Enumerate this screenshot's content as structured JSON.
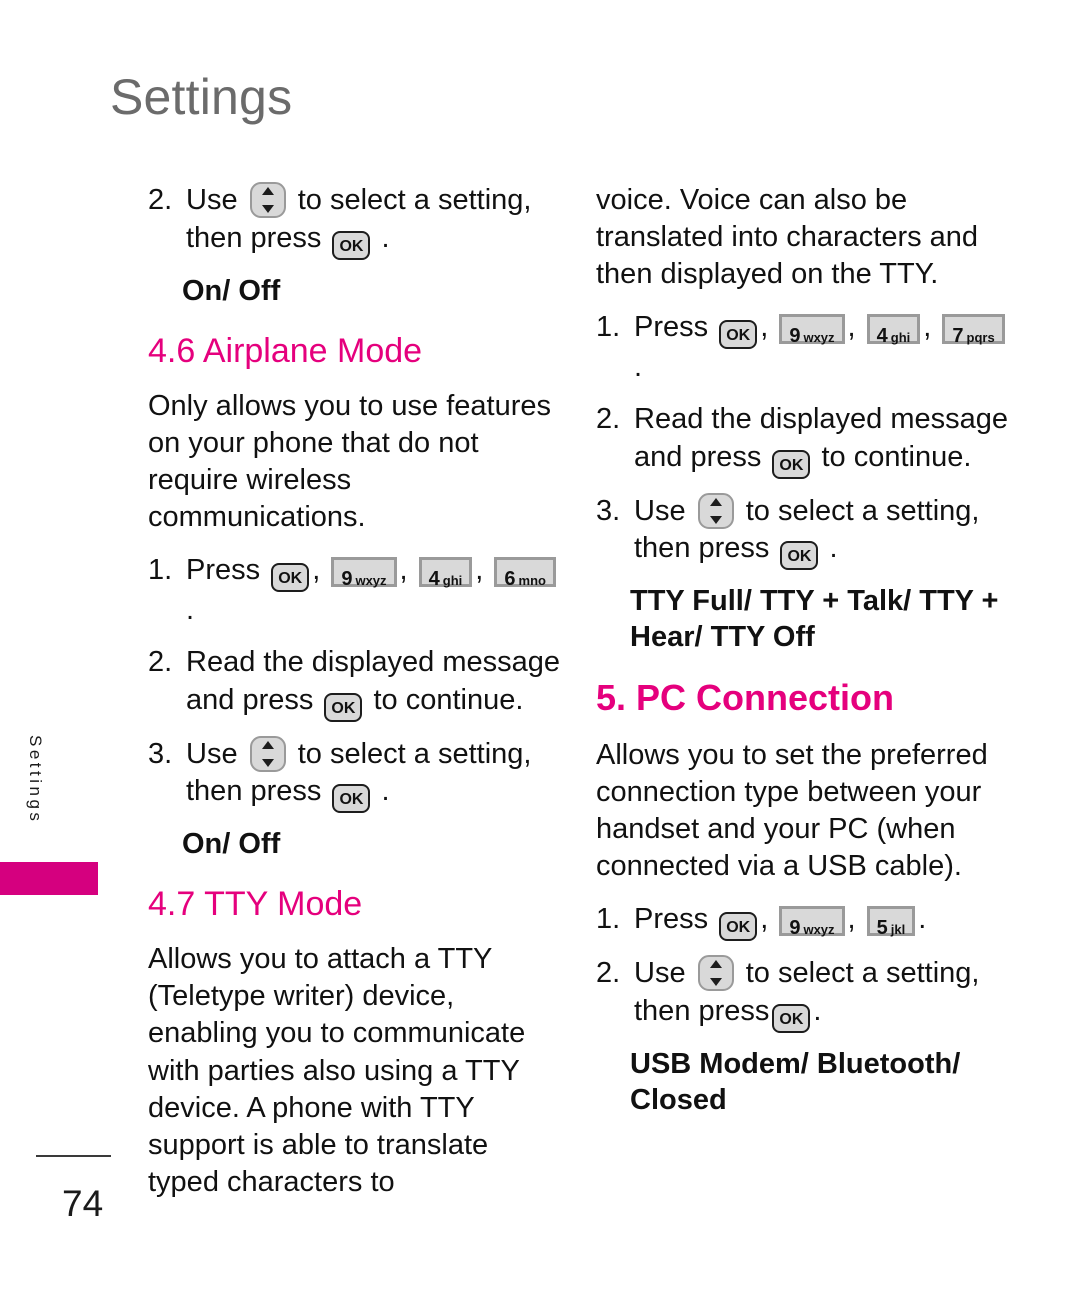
{
  "page": {
    "title": "Settings",
    "side_label": "Settings",
    "number": "74",
    "accent_color": "#e5007d",
    "tab_color": "#d5007f",
    "title_color": "#6b6b6b"
  },
  "keys": {
    "ok": "OK",
    "nav": "nav-up-down",
    "k9": {
      "digit": "9",
      "letters": "wxyz"
    },
    "k4": {
      "digit": "4",
      "letters": "ghi"
    },
    "k6": {
      "digit": "6",
      "letters": "mno"
    },
    "k7": {
      "digit": "7",
      "letters": "pqrs"
    },
    "k5": {
      "digit": "5",
      "letters": "jkl"
    }
  },
  "left_column": {
    "step_continued": {
      "num": "2.",
      "text_a": "Use",
      "text_b": "to select a setting,",
      "text_c": "then press",
      "text_d": "."
    },
    "subhead_1": "On/ Off",
    "section_46": {
      "heading": "4.6 Airplane Mode",
      "body": "Only allows you to use features on your phone that do not require wireless communications.",
      "steps": [
        {
          "num": "1.",
          "text_a": "Press",
          "sep1": ",",
          "sep2": ",",
          "sep3": ",",
          "end": "."
        },
        {
          "num": "2.",
          "text_a": "Read the displayed message and press",
          "text_b": "to continue."
        },
        {
          "num": "3.",
          "text_a": "Use",
          "text_b": "to select a setting,",
          "text_c": "then press",
          "text_d": "."
        }
      ],
      "subhead": "On/ Off"
    },
    "section_47": {
      "heading": "4.7 TTY Mode",
      "body": "Allows you to attach a TTY (Teletype writer) device, enabling you to communicate with parties also using a TTY device. A phone with TTY support is able to translate typed characters to"
    }
  },
  "right_column": {
    "body_continued": "voice. Voice can also be translated into characters and then displayed on the TTY.",
    "section_47_steps": [
      {
        "num": "1.",
        "text_a": "Press",
        "sep1": ",",
        "sep2": ",",
        "sep3": ",",
        "end": "."
      },
      {
        "num": "2.",
        "text_a": "Read the displayed message and press",
        "text_b": "to continue."
      },
      {
        "num": "3.",
        "text_a": "Use",
        "text_b": "to select a setting,",
        "text_c": "then press",
        "text_d": "."
      }
    ],
    "section_47_subhead": "TTY Full/ TTY + Talk/ TTY + Hear/ TTY Off",
    "section_5": {
      "heading": "5. PC Connection",
      "body": "Allows you to set the preferred connection type between your handset and your PC (when connected via a USB cable).",
      "steps": [
        {
          "num": "1.",
          "text_a": "Press",
          "sep1": ",",
          "sep2": ",",
          "end": "."
        },
        {
          "num": "2.",
          "text_a": "Use",
          "text_b": "to select a setting,",
          "text_c": "then press",
          "text_d": "."
        }
      ],
      "subhead": "USB Modem/ Bluetooth/ Closed"
    }
  }
}
